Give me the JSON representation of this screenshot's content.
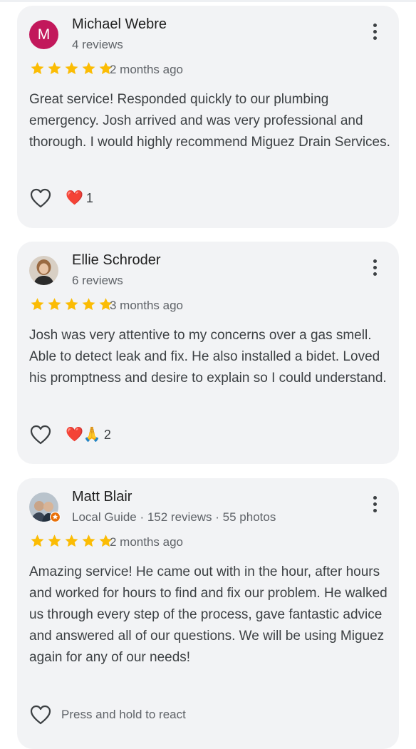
{
  "reviews": [
    {
      "avatar_letter": "M",
      "name": "Michael Webre",
      "meta": "4 reviews",
      "rating": 5,
      "date": "2 months ago",
      "text": "Great service! Responded quickly to our plumbing emergency. Josh arrived and was very professional and thorough. I would highly recommend Miguez Drain Services.",
      "reactions": "❤️",
      "reaction_count": "1"
    },
    {
      "name": "Ellie Schroder",
      "meta": "6 reviews",
      "rating": 5,
      "date": "3 months ago",
      "text": "Josh was very attentive to my concerns over a gas smell. Able to detect leak and fix. He also installed a bidet. Loved his promptness and desire to explain so I could understand.",
      "reactions": "❤️🙏",
      "reaction_count": "2"
    },
    {
      "name": "Matt Blair",
      "meta": "Local Guide · 152 reviews · 55 photos",
      "rating": 5,
      "date": "2 months ago",
      "text": "Amazing service! He came out with in the hour, after hours and worked for hours to find and fix our problem. He walked us through every step of the process, gave fantastic advice and answered all of our questions. We will be using Miguez again for any of our needs!",
      "react_hint": "Press and hold to react"
    }
  ],
  "colors": {
    "star": "#fbbc04",
    "avatar_m": "#c2185b",
    "card_bg": "#f2f3f5",
    "local_guide_badge": "#e8710a"
  },
  "icons": [
    "star-icon",
    "more-vert-icon",
    "heart-outline-icon",
    "local-guide-badge-icon"
  ]
}
